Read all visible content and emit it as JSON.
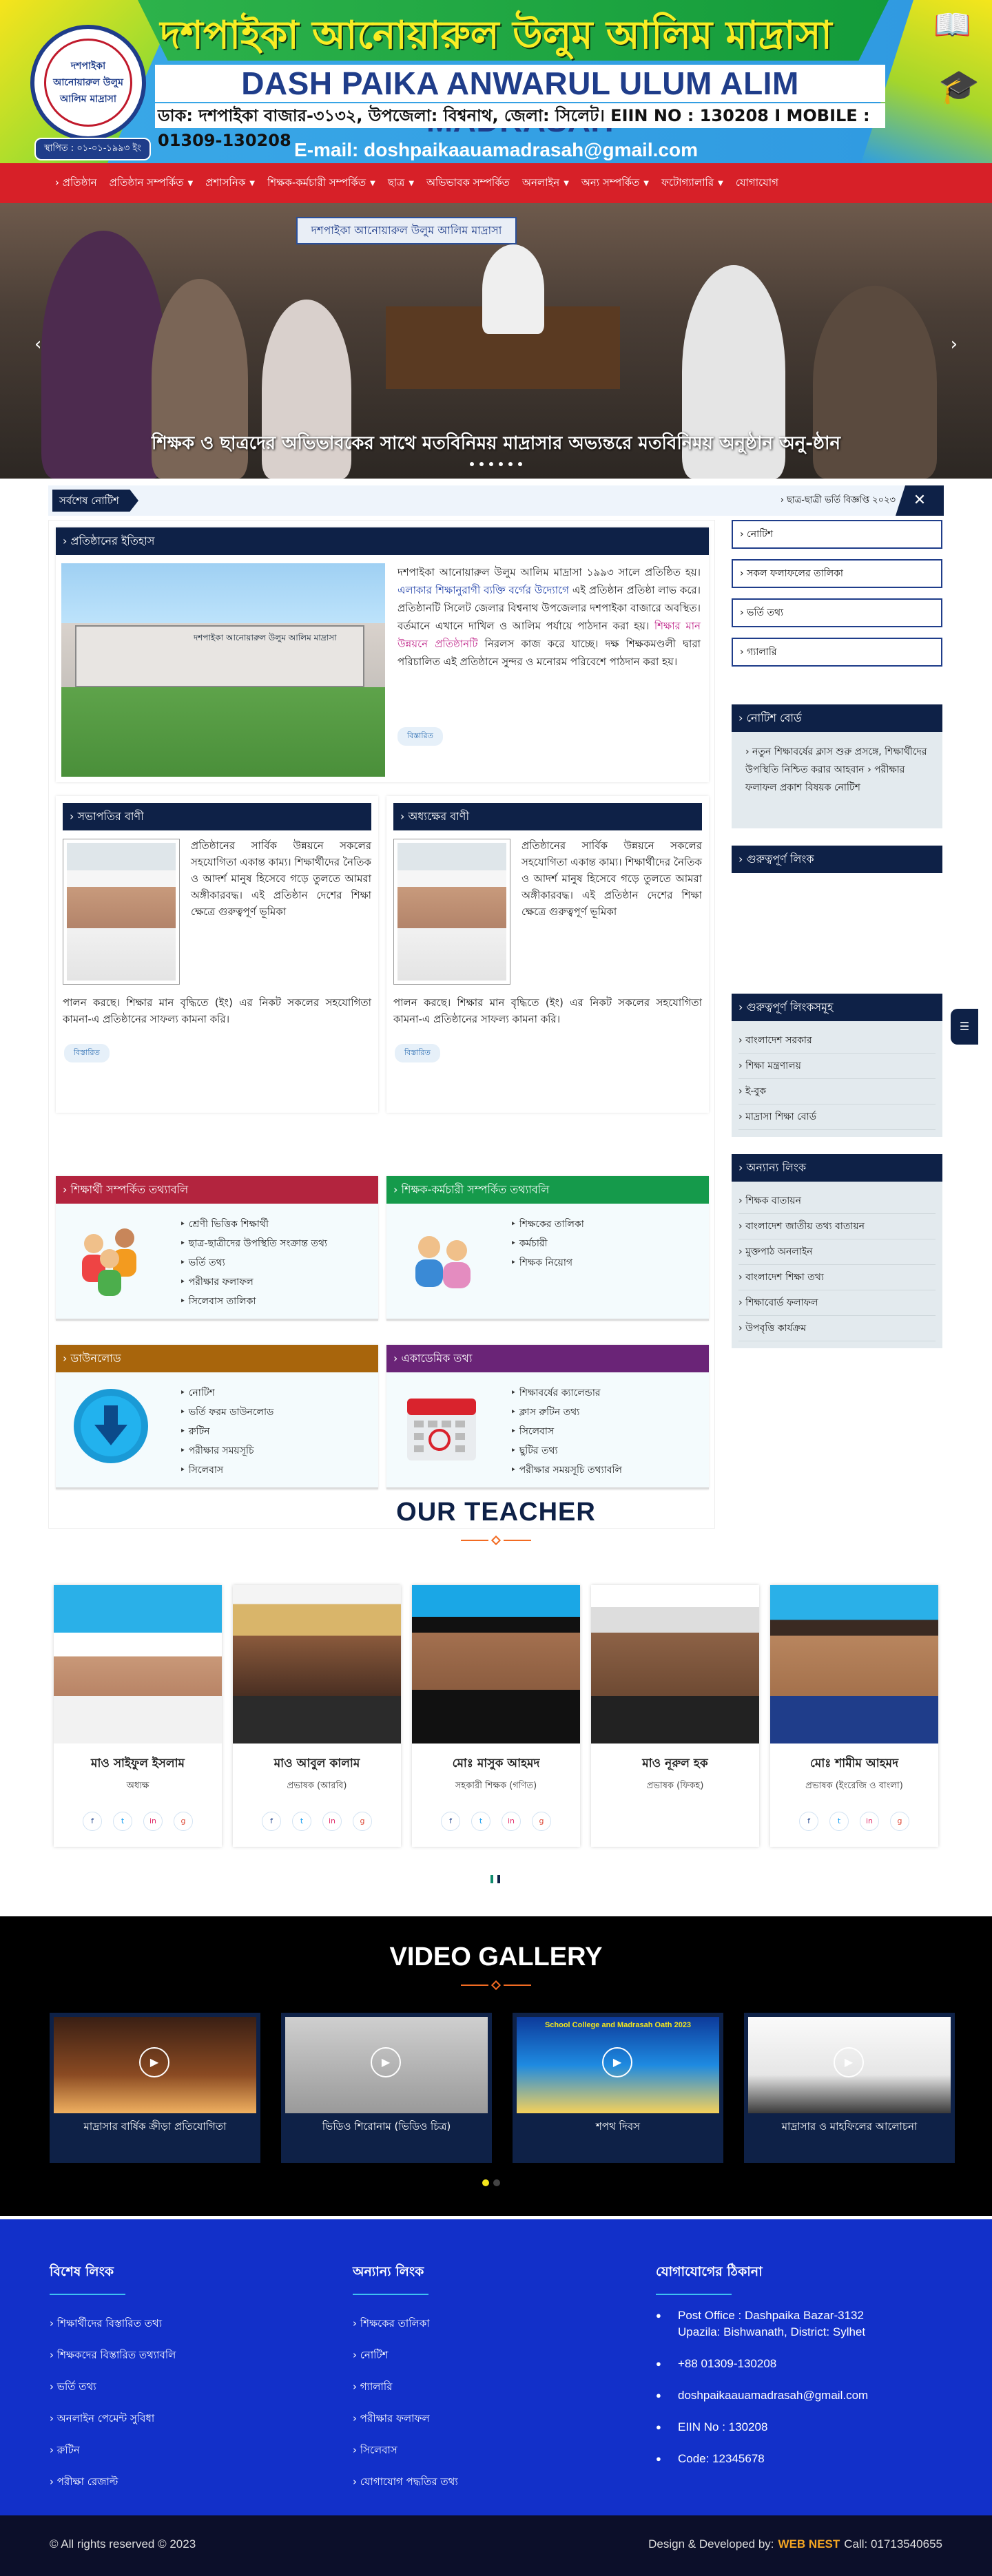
{
  "header": {
    "title_bn": "দশপাইকা আনোয়ারুল উলুম আলিম মাদ্রাসা",
    "title_en": "DASH PAIKA ANWARUL ULUM ALIM MADRASAH",
    "address": "ডাক: দশপাইকা বাজার-৩১৩২, উপজেলা: বিশ্বনাথ, জেলা: সিলেট। EIIN NO : 130208 I MOBILE : 01309-130208",
    "email": "E-mail: doshpaikaauamadrasah@gmail.com",
    "logo_text": "দশপাইকা আনোয়ারুল উলুম আলিম মাদ্রাসা",
    "est": "স্থাপিত : ০১-০১-১৯৯৩ ইং"
  },
  "nav": {
    "items": [
      {
        "label": "› প্রতিষ্ঠান",
        "caret": false
      },
      {
        "label": "প্রতিষ্ঠান সম্পর্কিত",
        "caret": true
      },
      {
        "label": "প্রশাসনিক",
        "caret": true
      },
      {
        "label": "শিক্ষক-কর্মচারী সম্পর্কিত",
        "caret": true
      },
      {
        "label": "ছাত্র",
        "caret": true
      },
      {
        "label": "অভিভাবক সম্পর্কিত",
        "caret": false
      },
      {
        "label": "অনলাইন",
        "caret": true
      },
      {
        "label": "অন্য সম্পর্কিত",
        "caret": true
      },
      {
        "label": "ফটোগ্যালারি",
        "caret": true
      },
      {
        "label": "যোগাযোগ",
        "caret": false
      }
    ]
  },
  "slider": {
    "banner": "দশপাইকা আনোয়ারুল উলুম আলিম মাদ্রাসা",
    "caption": "শিক্ষক ও ছাত্রদের অভিভাবকের সাথে মতবিনিময় মাদ্রাসার অভ্যন্তরে মতবিনিময় অনুষ্ঠান অনু-ষ্ঠান",
    "prev": "‹",
    "next": "›"
  },
  "ticker": {
    "label": "সর্বশেষ নোটিশ",
    "text": "› ছাত্র-ছাত্রী ভর্তি বিজ্ঞপ্তি ২০২৩",
    "close": "✕"
  },
  "intro": {
    "heading": "› প্রতিষ্ঠানের ইতিহাস",
    "photo_label": "দশপাইকা আনোয়ারুল উলুম আলিম মাদ্রাসা",
    "para_1": "দশপাইকা আনোয়ারুল উলুম আলিম মাদ্রাসা ১৯৯৩ সালে প্রতিষ্ঠিত হয়।",
    "para_blue": " এলাকার শিক্ষানুরাগী ব্যক্তি বর্গের উদ্যোগে",
    "para_2": " এই প্রতিষ্ঠান প্রতিষ্ঠা লাভ করে। প্রতিষ্ঠানটি সিলেট জেলার বিশ্বনাথ উপজেলার দশপাইকা বাজারে অবস্থিত। বর্তমানে এখানে দাখিল ও আলিম পর্যায়ে পাঠদান করা হয়।",
    "para_pink": " শিক্ষার মান উন্নয়নে প্রতিষ্ঠানটি",
    "para_3": " নিরলস কাজ করে যাচ্ছে। দক্ষ শিক্ষকমণ্ডলী দ্বারা পরিচালিত এই প্রতিষ্ঠানে সুন্দর ও মনোরম পরিবেশে পাঠদান করা হয়।",
    "more": "বিস্তারিত"
  },
  "messages": [
    {
      "heading": "› সভাপতির বাণী",
      "text_a": "প্রতিষ্ঠানের সার্বিক উন্নয়নে সকলের সহযোগিতা একান্ত কাম্য। শিক্ষার্থীদের নৈতিক ও আদর্শ মানুষ হিসেবে গড়ে তুলতে আমরা অঙ্গীকারবদ্ধ। এই প্রতিষ্ঠান দেশের শিক্ষা ক্ষেত্রে গুরুত্বপূর্ণ ভূমিকা",
      "text_b": "পালন করছে। শিক্ষার মান বৃদ্ধিতে (ইং) এর নিকট সকলের সহযোগিতা কামনা-এ প্রতিষ্ঠানের সাফল্য কামনা করি।",
      "more": "বিস্তারিত"
    },
    {
      "heading": "› অধ্যক্ষের বাণী",
      "text_a": "প্রতিষ্ঠানের সার্বিক উন্নয়নে সকলের সহযোগিতা একান্ত কাম্য। শিক্ষার্থীদের নৈতিক ও আদর্শ মানুষ হিসেবে গড়ে তুলতে আমরা অঙ্গীকারবদ্ধ। এই প্রতিষ্ঠান দেশের শিক্ষা ক্ষেত্রে গুরুত্বপূর্ণ ভূমিকা",
      "text_b": "পালন করছে। শিক্ষার মান বৃদ্ধিতে (ইং) এর নিকট সকলের সহযোগিতা কামনা-এ প্রতিষ্ঠানের সাফল্য কামনা করি।",
      "more": "বিস্তারিত"
    }
  ],
  "services": [
    {
      "heading": "› শিক্ষার্থী সম্পর্কিত তথ্যাবলি",
      "color": "#b3243e",
      "icon": "students-icon",
      "items": [
        "শ্রেণী ভিত্তিক শিক্ষার্থী",
        "ছাত্র-ছাত্রীদের উপস্থিতি সংক্রান্ত তথ্য",
        "ভর্তি তথ্য",
        "পরীক্ষার ফলাফল",
        "সিলেবাস তালিকা"
      ]
    },
    {
      "heading": "› শিক্ষক-কর্মচারী সম্পর্কিত তথ্যাবলি",
      "color": "#159a4b",
      "icon": "staff-icon",
      "items": [
        "শিক্ষকের তালিকা",
        "কর্মচারী",
        "শিক্ষক নিয়োগ"
      ]
    },
    {
      "heading": "› ডাউনলোড",
      "color": "#a8650c",
      "icon": "download-icon",
      "items": [
        "নোটিশ",
        "ভর্তি ফরম ডাউনলোড",
        "রুটিন",
        "পরীক্ষার সময়সূচি",
        "সিলেবাস"
      ]
    },
    {
      "heading": "› একাডেমিক তথ্য",
      "color": "#6a2477",
      "icon": "calendar-icon",
      "items": [
        "শিক্ষাবর্ষের ক্যালেন্ডার",
        "ক্লাস রুটিন তথ্য",
        "সিলেবাস",
        "ছুটির তথ্য",
        "পরীক্ষার সময়সূচি তথ্যাবলি"
      ]
    }
  ],
  "sidebar": {
    "buttons": [
      "› নোটিশ",
      "› সকল ফলাফলের তালিকা",
      "› ভর্তি তথ্য",
      "› গ্যালারি"
    ],
    "notice": {
      "heading": "› নোটিশ বোর্ড",
      "text": "› নতুন শিক্ষাবর্ষের ক্লাস শুরু প্রসঙ্গে, শিক্ষার্থীদের উপস্থিতি নিশ্চিত করার আহবান › পরীক্ষার ফলাফল প্রকাশ বিষয়ক নোটিশ"
    },
    "govt_heading": "› গুরুত্বপূর্ণ লিংক",
    "box1": {
      "heading": "› গুরুত্বপূর্ণ লিংকসমূহ",
      "items": [
        "বাংলাদেশ সরকার",
        "শিক্ষা মন্ত্রণালয়",
        "ই-বুক",
        "মাদ্রাসা শিক্ষা বোর্ড"
      ]
    },
    "box2": {
      "heading": "› অন্যান্য লিংক",
      "items": [
        "শিক্ষক বাতায়ন",
        "বাংলাদেশ জাতীয় তথ্য বাতায়ন",
        "মুক্তপাঠ অনলাইন",
        "বাংলাদেশ শিক্ষা তথ্য",
        "শিক্ষাবোর্ড ফলাফল",
        "উপবৃত্তি কার্যক্রম"
      ]
    },
    "float": "☰"
  },
  "teachers": {
    "heading": "OUR TEACHER",
    "list": [
      {
        "name": "মাও সাইফুল ইসলাম",
        "role": "অধ্যক্ষ"
      },
      {
        "name": "মাও আবুল কালাম",
        "role": "প্রভাষক (আরবি)"
      },
      {
        "name": "মোঃ মাসুক আহমদ",
        "role": "সহকারী শিক্ষক (গণিত)"
      },
      {
        "name": "মাও নূরুল হক",
        "role": "প্রভাষক (ফিকহ)"
      },
      {
        "name": "মোঃ শামীম আহমদ",
        "role": "প্রভাষক (ইংরেজি ও বাংলা)"
      }
    ],
    "social": [
      "f",
      "t",
      "in",
      "g"
    ]
  },
  "videos": {
    "heading": "VIDEO GALLERY",
    "list": [
      {
        "title": "মাদ্রাসার বার্ষিক ক্রীড়া প্রতিযোগিতা"
      },
      {
        "title": "ভিডিও শিরোনাম (ভিডিও চিত্র)"
      },
      {
        "title": "শপথ দিবস",
        "banner": "School College and Madrasah Oath 2023"
      },
      {
        "title": "মাদ্রাসার ও মাহফিলের আলোচনা"
      }
    ]
  },
  "footer": {
    "col1": {
      "heading": "বিশেষ লিংক",
      "items": [
        "শিক্ষার্থীদের বিস্তারিত তথ্য",
        "শিক্ষকদের বিস্তারিত তথ্যাবলি",
        "ভর্তি তথ্য",
        "অনলাইন পেমেন্ট সুবিধা",
        "রুটিন",
        "পরীক্ষা রেজাল্ট"
      ]
    },
    "col2": {
      "heading": "অন্যান্য লিংক",
      "items": [
        "শিক্ষকের তালিকা",
        "নোটিশ",
        "গ্যালারি",
        "পরীক্ষার ফলাফল",
        "সিলেবাস",
        "যোগাযোগ পদ্ধতির তথ্য"
      ]
    },
    "col3": {
      "heading": "যোগাযোগের ঠিকানা",
      "address_1": "Post Office : Dashpaika Bazar-3132",
      "address_2": "Upazila: Bishwanath, District: Sylhet",
      "phone": "+88 01309-130208",
      "email": "doshpaikaauamadrasah@gmail.com",
      "eiin": "EIIN No : 130208",
      "code": "Code: 12345678"
    }
  },
  "copyright": {
    "left": "© All rights reserved © 2023",
    "designed": "Design & Developed by:",
    "brand": "WEB NEST",
    "call": "Call: 01713540655"
  }
}
